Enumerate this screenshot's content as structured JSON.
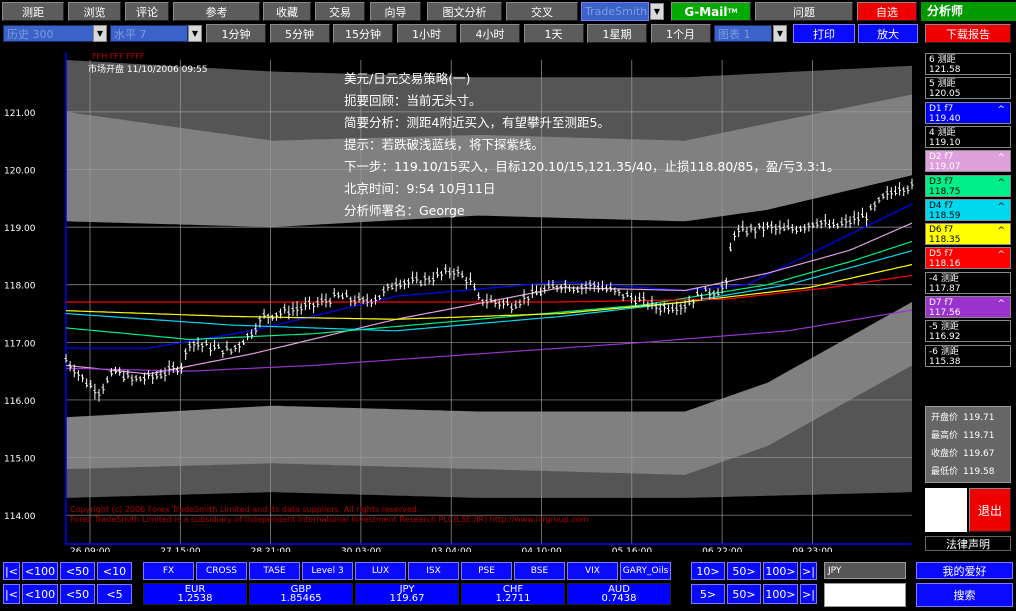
{
  "toolbar1": [
    {
      "label": "测距",
      "style": "grey"
    },
    {
      "label": "浏览",
      "style": "grey"
    },
    {
      "label": "评论",
      "style": "grey"
    },
    {
      "label": "参考",
      "style": "grey"
    },
    {
      "label": "收藏",
      "style": "grey"
    },
    {
      "label": "交易",
      "style": "grey"
    },
    {
      "label": "向导",
      "style": "grey"
    },
    {
      "label": "图文分析",
      "style": "grey"
    },
    {
      "label": "交叉",
      "style": "grey"
    }
  ],
  "tradesmith_label": "TradeSmith",
  "gmail_label": "G-Mail",
  "gmail_tm": "TM",
  "questions_label": "问题",
  "custom_label": "自选",
  "analyst_label": "分析师",
  "download_label": "下载报告",
  "history_value": "历史 300",
  "level_value": "水平 7",
  "timeframes": [
    "1分钟",
    "5分钟",
    "15分钟",
    "1小时",
    "4小时",
    "1天",
    "1星期",
    "1个月"
  ],
  "chart_select_value": "图表 1",
  "print_label": "打印",
  "zoom_label": "放大",
  "legend_top": "FFH  FFF  FFFF",
  "open_label": "市场开盘 11/10/2006 09:55",
  "annotations": [
    "美元/日元交易策略(一)",
    "扼要回顾：当前无头寸。",
    "简要分析：测距4附近买入，有望攀升至测距5。",
    "提示：若跌破浅蓝线，将下探紫线。",
    "下一步：119.10/15买入，目标120.10/15,121.35/40，止损118.80/85，盈/亏3.3:1。",
    "北京时间：9:54  10月11日",
    "分析师署名：George"
  ],
  "copyright_lines": [
    "Copyright (c) 2006 Forex TradeSmith Limited and its data suppliers.  All rights reserved.",
    "Forex TradeSmith Limited is a subsidiary of Independent International Investment Research PLC(LSE:IIR)  http://www.iiirgroup.com"
  ],
  "y_ticks": [
    {
      "label": "121.00",
      "v": 121
    },
    {
      "label": "120.00",
      "v": 120
    },
    {
      "label": "119.00",
      "v": 119
    },
    {
      "label": "118.00",
      "v": 118
    },
    {
      "label": "117.00",
      "v": 117
    },
    {
      "label": "116.00",
      "v": 116
    },
    {
      "label": "115.00",
      "v": 115
    },
    {
      "label": "114.00",
      "v": 114
    }
  ],
  "x_ticks": [
    "26 09:00",
    "27 15:00",
    "28 21:00",
    "30 03:00",
    "03 04:00",
    "04 10:00",
    "05 16:00",
    "06 22:00",
    "09 23:00"
  ],
  "side_levels": [
    {
      "name": "6 测距",
      "value": "121.58",
      "bg": "#000000",
      "fg": "#ffffff",
      "arrow": ""
    },
    {
      "name": "5 测距",
      "value": "120.05",
      "bg": "#000000",
      "fg": "#ffffff",
      "arrow": ""
    },
    {
      "name": "D1  f7",
      "value": "119.40",
      "bg": "#0000ff",
      "fg": "#ffffff",
      "arrow": "^"
    },
    {
      "name": "4 测距",
      "value": "119.10",
      "bg": "#000000",
      "fg": "#ffffff",
      "arrow": ""
    },
    {
      "name": "D2  f7",
      "value": "119.07",
      "bg": "#dda0dd",
      "fg": "#ffffff",
      "arrow": "^"
    },
    {
      "name": "D3  f7",
      "value": "118.75",
      "bg": "#00ee88",
      "fg": "#000000",
      "arrow": "^"
    },
    {
      "name": "D4  f7",
      "value": "118.59",
      "bg": "#00d8f0",
      "fg": "#000000",
      "arrow": "^"
    },
    {
      "name": "D6  f7",
      "value": "118.35",
      "bg": "#ffff00",
      "fg": "#000000",
      "arrow": "^"
    },
    {
      "name": "D5  f7",
      "value": "118.16",
      "bg": "#ff0000",
      "fg": "#ffffff",
      "arrow": "^"
    },
    {
      "name": "-4 测距",
      "value": "117.87",
      "bg": "#000000",
      "fg": "#ffffff",
      "arrow": ""
    },
    {
      "name": "D7  f7",
      "value": "117.56",
      "bg": "#9933cc",
      "fg": "#ffffff",
      "arrow": "^"
    },
    {
      "name": "-5 测距",
      "value": "116.92",
      "bg": "#000000",
      "fg": "#ffffff",
      "arrow": ""
    },
    {
      "name": "-6 测距",
      "value": "115.38",
      "bg": "#000000",
      "fg": "#ffffff",
      "arrow": ""
    }
  ],
  "price_info": [
    {
      "label": "开盘价",
      "value": "119.71"
    },
    {
      "label": "最高价",
      "value": "119.71"
    },
    {
      "label": "收盘价",
      "value": "119.67"
    },
    {
      "label": "最低价",
      "value": "119.58"
    }
  ],
  "exit_label": "退出",
  "law_label": "法律声明",
  "nav_top": [
    "|<",
    "<100",
    "<50",
    "<10"
  ],
  "nav_bottom": [
    "|<",
    "<100",
    "<50",
    "<5"
  ],
  "nav_right_top": [
    "10>",
    "50>",
    "100>",
    ">|"
  ],
  "nav_right_bottom": [
    "5>",
    "50>",
    "100>",
    ">|"
  ],
  "markets": [
    "FX",
    "CROSS",
    "TASE",
    "Level 3",
    "LUX",
    "ISX",
    "PSE",
    "BSE",
    "VIX",
    "GARY_Oils"
  ],
  "quotes": [
    {
      "code": "EUR",
      "value": "1.2538"
    },
    {
      "code": "GBP",
      "value": "1.85465"
    },
    {
      "code": "JPY",
      "value": "119.67"
    },
    {
      "code": "CHF",
      "value": "1.2711"
    },
    {
      "code": "AUD",
      "value": "0.7438"
    }
  ],
  "symbol_value": "JPY",
  "favorites_label": "我的爱好",
  "search_label": "搜索",
  "chart_data": {
    "type": "candlestick",
    "ylim": [
      113.5,
      121.9
    ],
    "grid": true,
    "y_ticks": [
      114,
      115,
      116,
      117,
      118,
      119,
      120,
      121
    ],
    "x_labels": [
      "26 09:00",
      "27 15:00",
      "28 21:00",
      "30 03:00",
      "03 04:00",
      "04 10:00",
      "05 16:00",
      "06 22:00",
      "09 23:00"
    ],
    "price_path": [
      [
        0,
        116.7
      ],
      [
        5,
        116.3
      ],
      [
        8,
        116.15
      ],
      [
        12,
        116.5
      ],
      [
        16,
        116.35
      ],
      [
        21,
        116.4
      ],
      [
        25,
        116.5
      ],
      [
        28,
        116.6
      ],
      [
        30,
        117.0
      ],
      [
        36,
        116.9
      ],
      [
        40,
        116.85
      ],
      [
        44,
        117.1
      ],
      [
        48,
        117.45
      ],
      [
        54,
        117.55
      ],
      [
        60,
        117.65
      ],
      [
        66,
        117.8
      ],
      [
        72,
        117.7
      ],
      [
        76,
        117.8
      ],
      [
        80,
        118.05
      ],
      [
        85,
        118.05
      ],
      [
        90,
        118.15
      ],
      [
        94,
        118.25
      ],
      [
        98,
        118.05
      ],
      [
        100,
        117.75
      ],
      [
        104,
        117.7
      ],
      [
        108,
        117.65
      ],
      [
        112,
        117.8
      ],
      [
        116,
        117.9
      ],
      [
        120,
        118.0
      ],
      [
        124,
        117.95
      ],
      [
        128,
        118.0
      ],
      [
        132,
        117.9
      ],
      [
        136,
        117.8
      ],
      [
        140,
        117.7
      ],
      [
        144,
        117.6
      ],
      [
        150,
        117.65
      ],
      [
        154,
        117.85
      ],
      [
        158,
        117.9
      ],
      [
        160,
        118.0
      ],
      [
        161,
        118.6
      ],
      [
        162,
        118.9
      ],
      [
        166,
        118.95
      ],
      [
        170,
        119.0
      ],
      [
        174,
        118.95
      ],
      [
        178,
        119.0
      ],
      [
        182,
        119.1
      ],
      [
        186,
        119.0
      ],
      [
        190,
        119.1
      ],
      [
        194,
        119.2
      ],
      [
        198,
        119.5
      ],
      [
        202,
        119.7
      ],
      [
        204,
        119.7
      ]
    ],
    "bands": [
      {
        "name": "band-6",
        "color": "#555555",
        "upper": [
          [
            0,
            121.9
          ],
          [
            50,
            121.7
          ],
          [
            100,
            121.6
          ],
          [
            150,
            121.6
          ],
          [
            205,
            121.8
          ]
        ],
        "lower": [
          [
            0,
            114.3
          ],
          [
            50,
            114.4
          ],
          [
            100,
            114.3
          ],
          [
            150,
            114.3
          ],
          [
            205,
            114.4
          ]
        ]
      },
      {
        "name": "band-5",
        "color": "#808080",
        "upper": [
          [
            0,
            121.0
          ],
          [
            50,
            120.5
          ],
          [
            100,
            120.6
          ],
          [
            150,
            120.5
          ],
          [
            170,
            120.8
          ],
          [
            205,
            121.3
          ]
        ],
        "lower": [
          [
            0,
            114.8
          ],
          [
            50,
            114.9
          ],
          [
            100,
            114.8
          ],
          [
            150,
            114.7
          ],
          [
            170,
            115.2
          ],
          [
            205,
            116.6
          ]
        ]
      },
      {
        "name": "band-4",
        "color": "#000000",
        "upper": [
          [
            0,
            119.1
          ],
          [
            50,
            119.0
          ],
          [
            100,
            119.2
          ],
          [
            150,
            119.1
          ],
          [
            170,
            119.3
          ],
          [
            205,
            119.9
          ]
        ],
        "lower": [
          [
            0,
            115.7
          ],
          [
            50,
            115.9
          ],
          [
            100,
            115.8
          ],
          [
            150,
            115.8
          ],
          [
            170,
            116.3
          ],
          [
            205,
            117.7
          ]
        ]
      }
    ],
    "lines": [
      {
        "name": "D1",
        "color": "#0000ff",
        "points": [
          [
            0,
            116.9
          ],
          [
            20,
            116.9
          ],
          [
            45,
            117.2
          ],
          [
            80,
            117.8
          ],
          [
            120,
            118.05
          ],
          [
            150,
            117.9
          ],
          [
            165,
            118.0
          ],
          [
            185,
            118.7
          ],
          [
            205,
            119.4
          ]
        ]
      },
      {
        "name": "D2",
        "color": "#dda0dd",
        "points": [
          [
            0,
            116.6
          ],
          [
            20,
            116.45
          ],
          [
            45,
            116.8
          ],
          [
            80,
            117.4
          ],
          [
            120,
            117.95
          ],
          [
            150,
            117.9
          ],
          [
            170,
            118.2
          ],
          [
            190,
            118.6
          ],
          [
            205,
            119.07
          ]
        ]
      },
      {
        "name": "D3",
        "color": "#00ee88",
        "points": [
          [
            0,
            117.25
          ],
          [
            30,
            117.05
          ],
          [
            60,
            117.15
          ],
          [
            100,
            117.4
          ],
          [
            140,
            117.65
          ],
          [
            170,
            118.0
          ],
          [
            190,
            118.4
          ],
          [
            205,
            118.75
          ]
        ]
      },
      {
        "name": "D4",
        "color": "#00d8f0",
        "points": [
          [
            0,
            117.5
          ],
          [
            40,
            117.3
          ],
          [
            80,
            117.2
          ],
          [
            120,
            117.45
          ],
          [
            150,
            117.7
          ],
          [
            175,
            118.0
          ],
          [
            205,
            118.59
          ]
        ]
      },
      {
        "name": "D6",
        "color": "#ffff00",
        "points": [
          [
            0,
            117.55
          ],
          [
            40,
            117.45
          ],
          [
            80,
            117.4
          ],
          [
            120,
            117.5
          ],
          [
            150,
            117.7
          ],
          [
            180,
            117.95
          ],
          [
            205,
            118.35
          ]
        ]
      },
      {
        "name": "D5",
        "color": "#ff0000",
        "points": [
          [
            0,
            117.7
          ],
          [
            40,
            117.7
          ],
          [
            80,
            117.7
          ],
          [
            120,
            117.7
          ],
          [
            160,
            117.75
          ],
          [
            185,
            117.95
          ],
          [
            205,
            118.16
          ]
        ]
      },
      {
        "name": "D7",
        "color": "#9933cc",
        "points": [
          [
            0,
            116.55
          ],
          [
            30,
            116.5
          ],
          [
            60,
            116.6
          ],
          [
            100,
            116.8
          ],
          [
            140,
            117.0
          ],
          [
            175,
            117.2
          ],
          [
            205,
            117.56
          ]
        ]
      }
    ]
  }
}
